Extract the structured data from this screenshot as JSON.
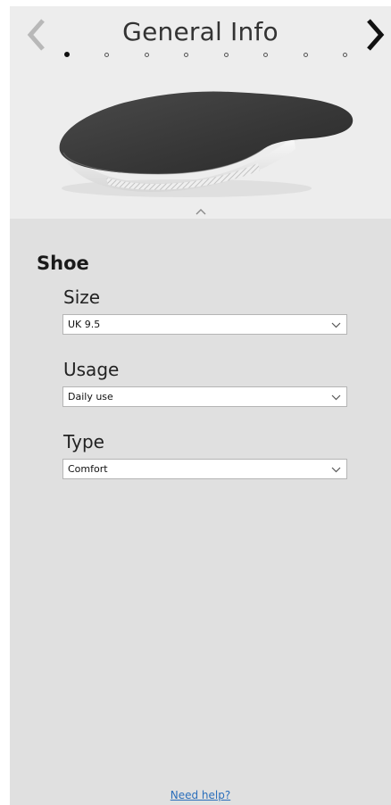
{
  "header": {
    "title": "General Info",
    "prev_icon": "chevron-left-icon",
    "next_icon": "chevron-right-icon",
    "step_count": 8,
    "active_step": 1,
    "collapse_icon": "chevron-up-icon"
  },
  "shoe": {
    "section_title": "Shoe",
    "fields": [
      {
        "label": "Size",
        "value": "UK 9.5"
      },
      {
        "label": "Usage",
        "value": "Daily use"
      },
      {
        "label": "Type",
        "value": "Comfort"
      }
    ]
  },
  "footer": {
    "help_link": "Need help?"
  },
  "colors": {
    "header_bg": "#ededed",
    "panel_bg": "#e0e0e0",
    "link": "#2a6ebb",
    "insole_top": "#3c3c3c",
    "insole_base": "#f2f2f2"
  }
}
